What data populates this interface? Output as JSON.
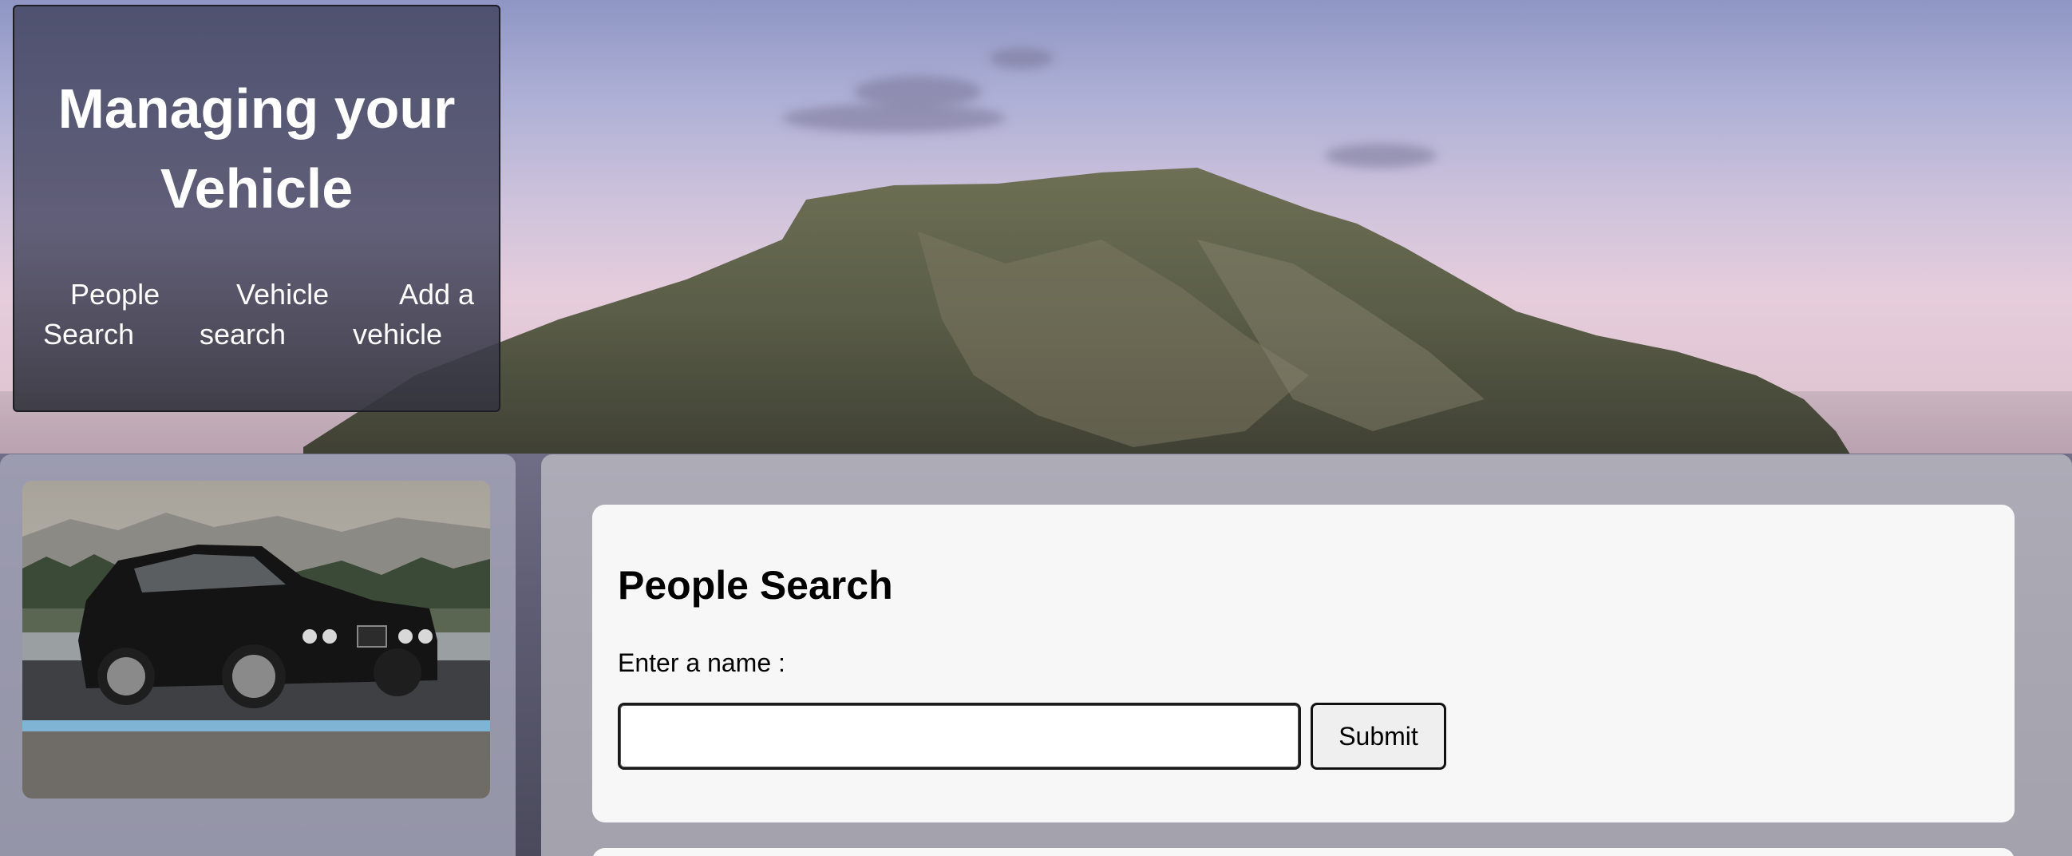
{
  "header": {
    "title": "Managing your Vehicle"
  },
  "nav": {
    "people_search": "People Search",
    "vehicle_search": "Vehicle search",
    "add_vehicle": "Add a vehicle"
  },
  "sidebar": {
    "image_icon": "car-photo"
  },
  "search": {
    "title": "People Search",
    "name_label": "Enter a name :",
    "input_value": "",
    "input_placeholder": "",
    "submit_label": "Submit"
  }
}
